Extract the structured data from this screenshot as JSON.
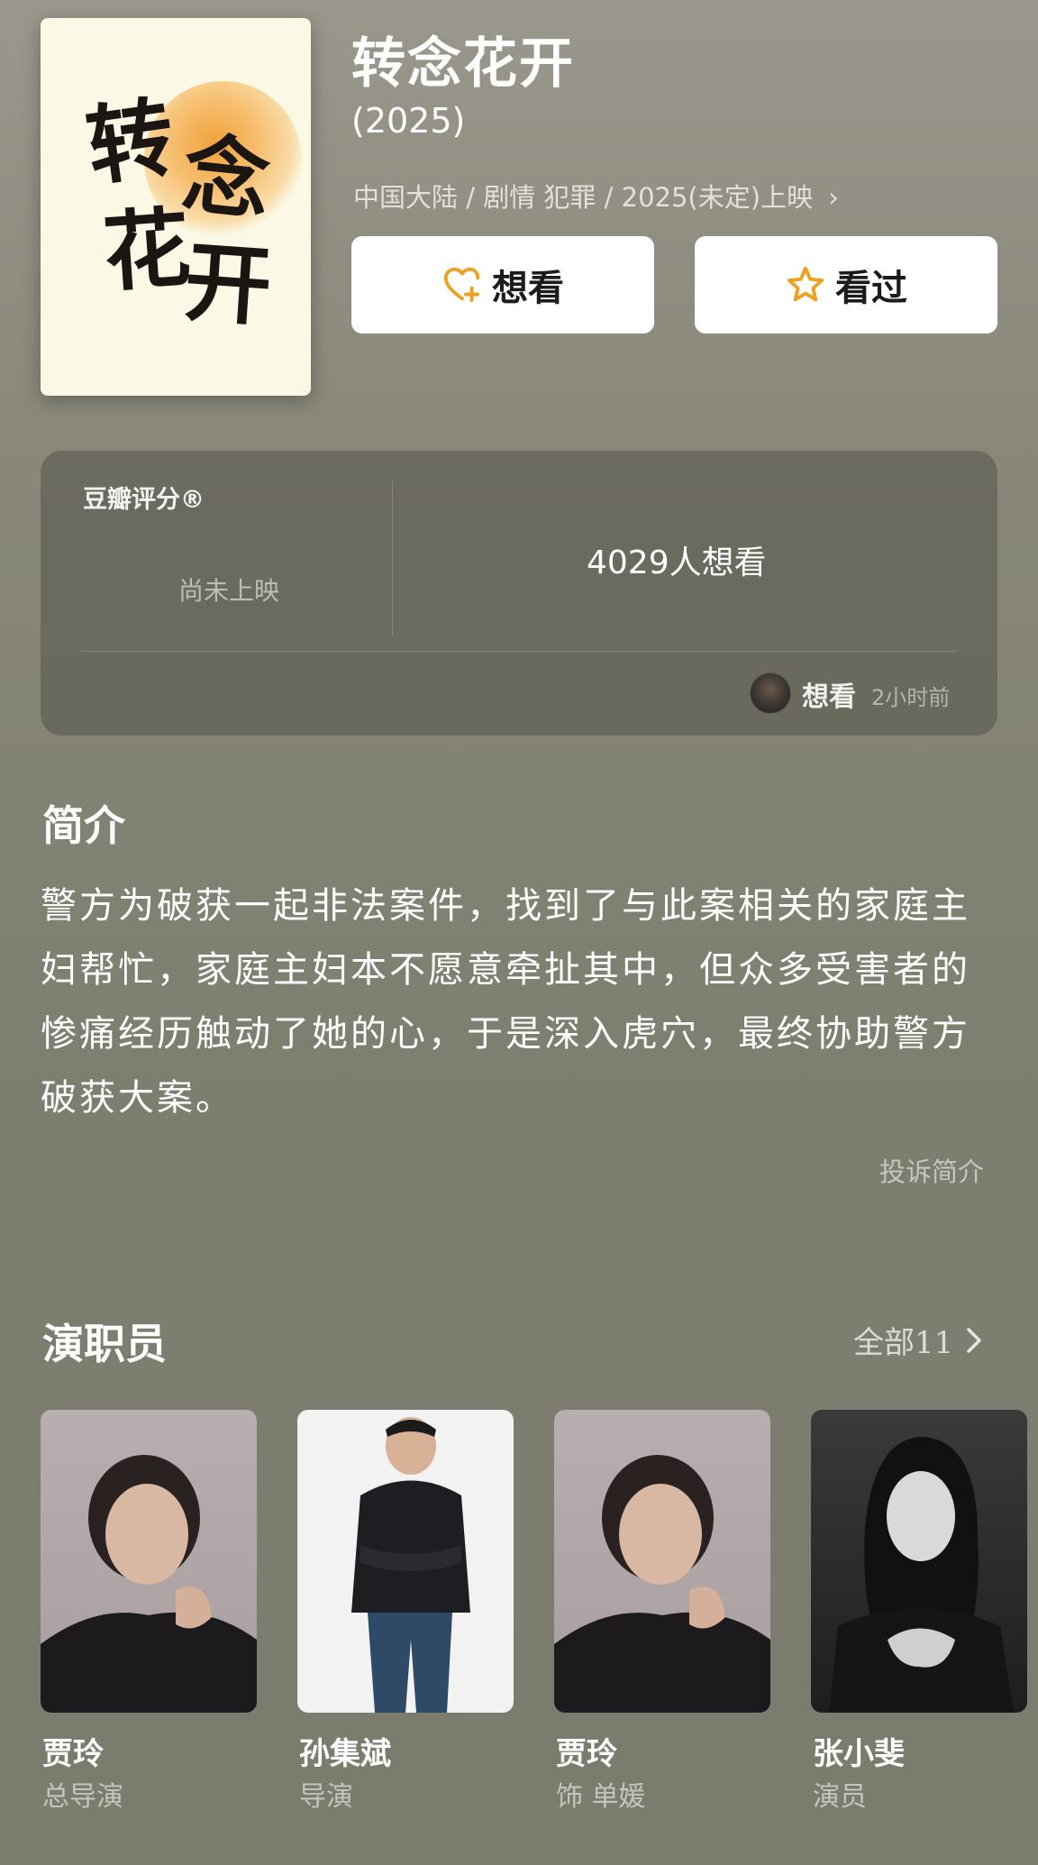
{
  "movie": {
    "poster_text": "转念花开",
    "title": "转念花开",
    "year": "(2025)",
    "meta": "中国大陆 / 剧情 犯罪 / 2025(未定)上映"
  },
  "actions": {
    "want_label": "想看",
    "watched_label": "看过",
    "want_icon": "heart-plus-icon",
    "watched_icon": "star-icon",
    "accent_color": "#f0a020"
  },
  "rating": {
    "label": "豆瓣评分®",
    "status": "尚未上映",
    "want_count": "4029人想看",
    "recent_action": "想看",
    "recent_time": "2小时前"
  },
  "intro": {
    "heading": "简介",
    "text": "警方为破获一起非法案件，找到了与此案相关的家庭主妇帮忙，家庭主妇本不愿意牵扯其中，但众多受害者的惨痛经历触动了她的心，于是深入虎穴，最终协助警方破获大案。",
    "report_label": "投诉简介"
  },
  "cast": {
    "heading": "演职员",
    "all_label": "全部11",
    "members": [
      {
        "name": "贾玲",
        "role": "总导演"
      },
      {
        "name": "孙集斌",
        "role": "导演"
      },
      {
        "name": "贾玲",
        "role": "饰 单媛"
      },
      {
        "name": "张小斐",
        "role": "演员"
      }
    ]
  }
}
